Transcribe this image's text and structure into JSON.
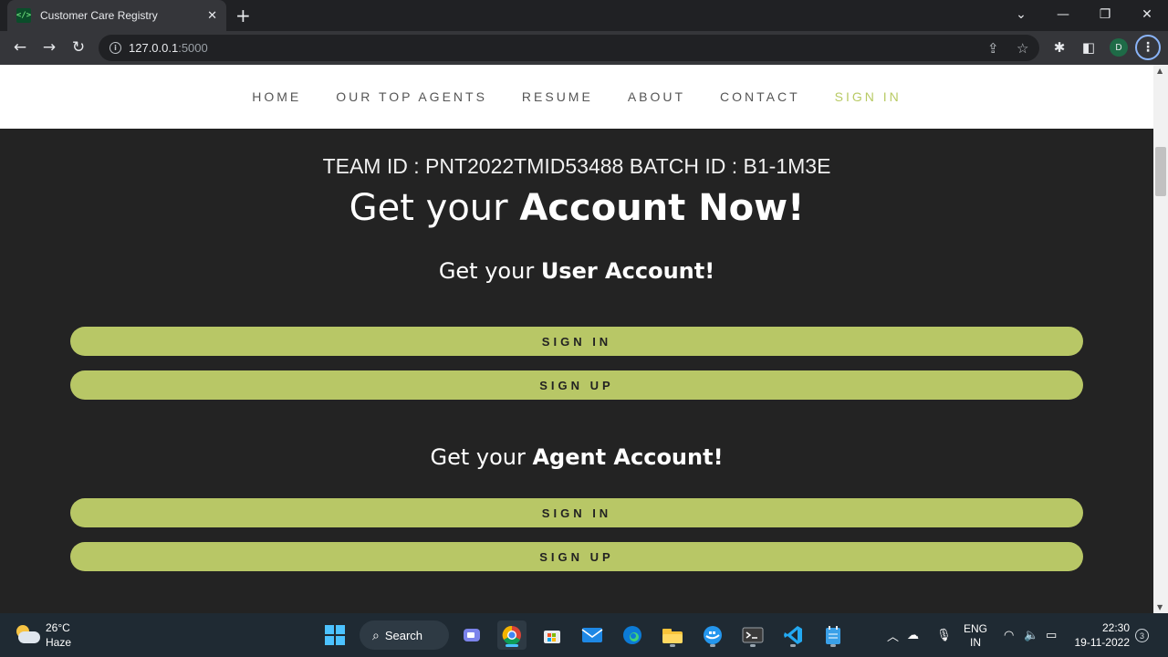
{
  "browser": {
    "tab_title": "Customer Care Registry",
    "tab_close": "✕",
    "new_tab": "+",
    "url_host": "127.0.0.1",
    "url_port": ":5000",
    "profile_initial": "D"
  },
  "site_nav": {
    "items": [
      {
        "label": "HOME"
      },
      {
        "label": "OUR TOP AGENTS"
      },
      {
        "label": "RESUME"
      },
      {
        "label": "ABOUT"
      },
      {
        "label": "CONTACT"
      },
      {
        "label": "SIGN IN"
      }
    ],
    "active_color": "#b8ca64"
  },
  "main": {
    "team_line": "TEAM ID : PNT2022TMID53488 BATCH ID : B1-1M3E",
    "headline_light": "Get your ",
    "headline_bold": "Account Now!",
    "user_section": {
      "light": "Get your ",
      "bold": "User Account!",
      "sign_in": "SIGN IN",
      "sign_up": "SIGN UP"
    },
    "agent_section": {
      "light": "Get your ",
      "bold": "Agent Account!",
      "sign_in": "SIGN IN",
      "sign_up": "SIGN UP"
    },
    "button_color": "#b8c766"
  },
  "taskbar": {
    "temperature": "26°C",
    "condition": "Haze",
    "search_label": "Search",
    "lang_top": "ENG",
    "lang_bottom": "IN",
    "time": "22:30",
    "date": "19-11-2022",
    "notification_count": "3"
  }
}
